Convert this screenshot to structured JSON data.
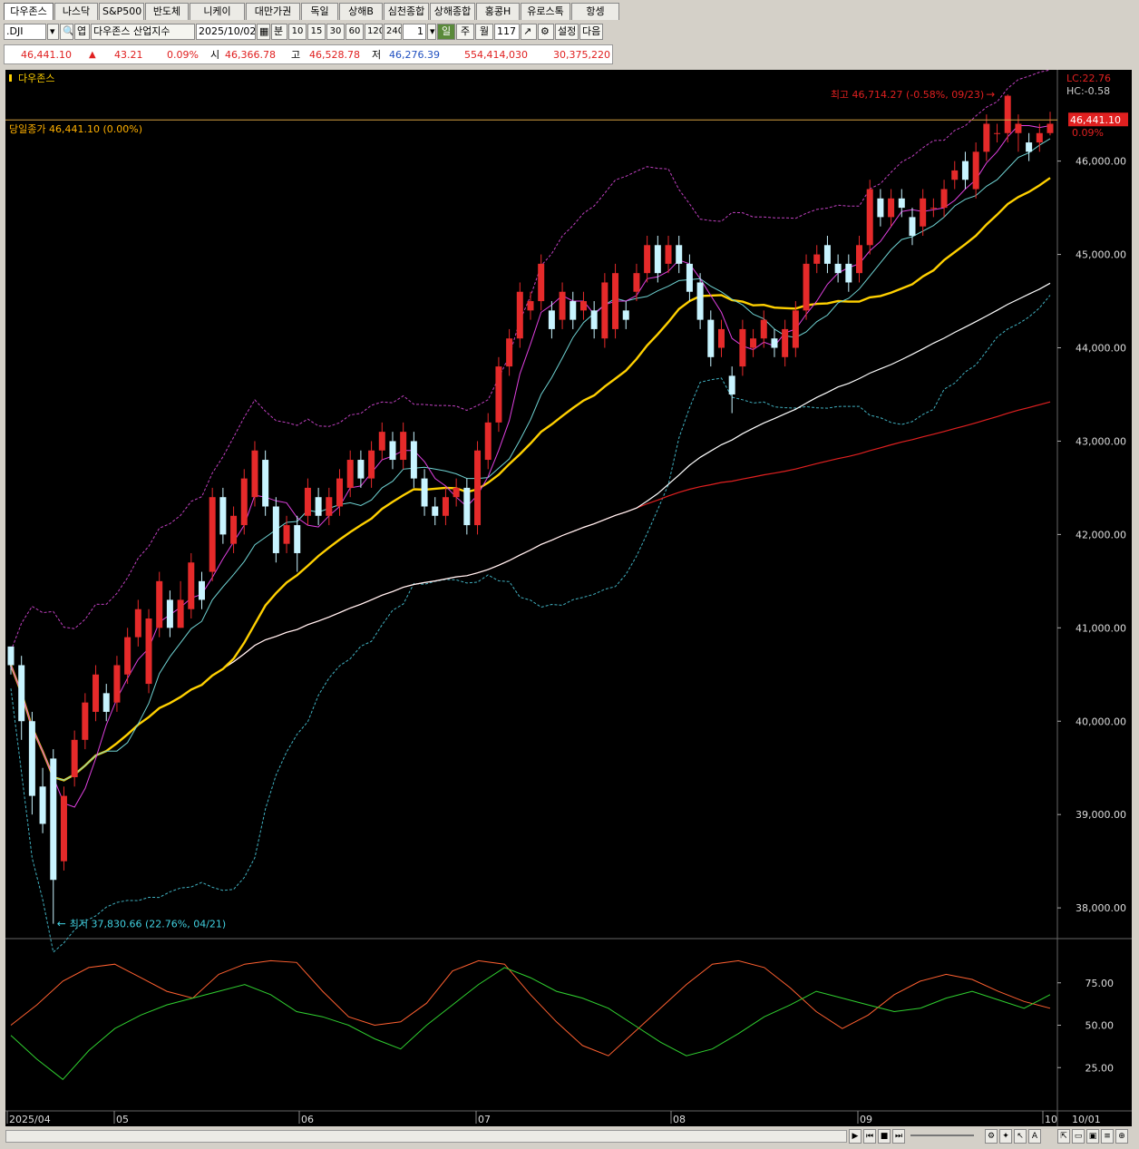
{
  "tabs": [
    "다우존스",
    "나스닥",
    "S&P500",
    "반도체",
    "니케이",
    "대만가권",
    "독일",
    "상해B",
    "심천종합",
    "상해종합",
    "홍콩H",
    "유로스톡",
    "항셍"
  ],
  "toolbar": {
    "symbol": ".DJI",
    "index_name": "다우존스 산업지수",
    "date": "2025/10/02",
    "period_unit": "분",
    "minute_options": [
      "10",
      "15",
      "30",
      "60",
      "120",
      "240"
    ],
    "multiplier": "1",
    "period_day": "일",
    "period_week": "주",
    "period_month": "월",
    "count": "117",
    "settings_label": "설정",
    "next_label": "다음"
  },
  "quote": {
    "price": "46,441.10",
    "change": "43.21",
    "change_pct": "0.09%",
    "open_label": "시",
    "open": "46,366.78",
    "high_label": "고",
    "high": "46,528.78",
    "low_label": "저",
    "low": "46,276.39",
    "volume": "554,414,030",
    "amount": "30,375,220"
  },
  "chart": {
    "title": "다우존스",
    "close_label": "당일종가 46,441.10 (0.00%)",
    "high_annotation": "최고 46,714.27 (-0.58%, 09/23)",
    "low_annotation": "최저 37,830.66 (22.76%, 04/21)",
    "lc_label": "LC:22.76",
    "hc_label": "HC:-0.58",
    "current_price_tag": "46,441.10",
    "current_pct_tag": "0.09%",
    "y_ticks": [
      "46,000.00",
      "45,000.00",
      "44,000.00",
      "43,000.00",
      "42,000.00",
      "41,000.00",
      "40,000.00",
      "39,000.00",
      "38,000.00"
    ],
    "osc_ticks": [
      "75.00",
      "50.00",
      "25.00"
    ],
    "x_labels": [
      "2025/04",
      "05",
      "06",
      "07",
      "08",
      "09",
      "10",
      "10/01"
    ],
    "colors": {
      "up": "#e52a2a",
      "down": "#c8f4ff",
      "ma5": "#e040e0",
      "ma10": "#6fd3d3",
      "ma20": "#ffd000",
      "ma60": "#ffffff",
      "ma120": "#e02020"
    }
  },
  "chart_data": {
    "type": "candlestick",
    "x_range": [
      "2025/04/08",
      "2025/10/02"
    ],
    "ylim": [
      37700,
      46900
    ],
    "points": [
      [
        40800,
        40600,
        40700,
        40500
      ],
      [
        40600,
        40000,
        40700,
        39800
      ],
      [
        40000,
        39200,
        40100,
        39000
      ],
      [
        39300,
        38900,
        39500,
        38800
      ],
      [
        39600,
        38300,
        39700,
        37830
      ],
      [
        38500,
        39200,
        39300,
        38400
      ],
      [
        39400,
        39800,
        39900,
        39300
      ],
      [
        39800,
        40200,
        40300,
        39700
      ],
      [
        40100,
        40500,
        40600,
        40000
      ],
      [
        40300,
        40100,
        40400,
        40000
      ],
      [
        40200,
        40600,
        40700,
        40100
      ],
      [
        40500,
        40900,
        41000,
        40400
      ],
      [
        40900,
        41200,
        41300,
        40800
      ],
      [
        40400,
        41100,
        41200,
        40300
      ],
      [
        41000,
        41500,
        41600,
        40900
      ],
      [
        41300,
        41000,
        41400,
        40900
      ],
      [
        41000,
        41300,
        41500,
        41000
      ],
      [
        41200,
        41700,
        41800,
        41100
      ],
      [
        41500,
        41300,
        41600,
        41200
      ],
      [
        41600,
        42400,
        42500,
        41500
      ],
      [
        42400,
        42000,
        42500,
        41900
      ],
      [
        41900,
        42200,
        42300,
        41800
      ],
      [
        42100,
        42600,
        42700,
        42000
      ],
      [
        42400,
        42900,
        43000,
        42300
      ],
      [
        42800,
        42300,
        42900,
        42200
      ],
      [
        42300,
        41800,
        42400,
        41700
      ],
      [
        41900,
        42100,
        42200,
        41800
      ],
      [
        42100,
        41800,
        42200,
        41600
      ],
      [
        42200,
        42500,
        42600,
        42100
      ],
      [
        42400,
        42200,
        42500,
        42100
      ],
      [
        42200,
        42400,
        42500,
        42100
      ],
      [
        42300,
        42600,
        42700,
        42200
      ],
      [
        42500,
        42800,
        42900,
        42400
      ],
      [
        42800,
        42600,
        42900,
        42500
      ],
      [
        42600,
        42900,
        43000,
        42500
      ],
      [
        42900,
        43100,
        43200,
        42800
      ],
      [
        43000,
        42800,
        43100,
        42700
      ],
      [
        42800,
        43100,
        43200,
        42700
      ],
      [
        43000,
        42600,
        43100,
        42500
      ],
      [
        42600,
        42300,
        42700,
        42200
      ],
      [
        42300,
        42200,
        42400,
        42100
      ],
      [
        42200,
        42400,
        42500,
        42100
      ],
      [
        42400,
        42500,
        42600,
        42300
      ],
      [
        42500,
        42100,
        42600,
        42000
      ],
      [
        42100,
        42900,
        43000,
        42000
      ],
      [
        42800,
        43200,
        43300,
        42700
      ],
      [
        43200,
        43800,
        43900,
        43100
      ],
      [
        43800,
        44100,
        44200,
        43700
      ],
      [
        44100,
        44600,
        44700,
        44000
      ],
      [
        44400,
        44500,
        44600,
        44300
      ],
      [
        44500,
        44900,
        45000,
        44400
      ],
      [
        44400,
        44200,
        44500,
        44100
      ],
      [
        44300,
        44600,
        44700,
        44200
      ],
      [
        44500,
        44300,
        44600,
        44200
      ],
      [
        44400,
        44500,
        44600,
        44300
      ],
      [
        44400,
        44200,
        44500,
        44100
      ],
      [
        44100,
        44700,
        44800,
        44000
      ],
      [
        44200,
        44800,
        44900,
        44100
      ],
      [
        44400,
        44300,
        44500,
        44200
      ],
      [
        44600,
        44800,
        44900,
        44500
      ],
      [
        44800,
        45100,
        45200,
        44700
      ],
      [
        45100,
        44800,
        45200,
        44700
      ],
      [
        44900,
        45100,
        45200,
        44800
      ],
      [
        45100,
        44900,
        45200,
        44800
      ],
      [
        44900,
        44600,
        45000,
        44500
      ],
      [
        44700,
        44300,
        44800,
        44200
      ],
      [
        44300,
        43900,
        44400,
        43800
      ],
      [
        44000,
        44200,
        44300,
        43900
      ],
      [
        43700,
        43500,
        43800,
        43300
      ],
      [
        43800,
        44200,
        44300,
        43700
      ],
      [
        44000,
        44100,
        44200,
        43900
      ],
      [
        44100,
        44300,
        44400,
        44000
      ],
      [
        44100,
        44000,
        44200,
        43900
      ],
      [
        43900,
        44200,
        44300,
        43800
      ],
      [
        44000,
        44400,
        44500,
        43900
      ],
      [
        44400,
        44900,
        45000,
        44300
      ],
      [
        44900,
        45000,
        45100,
        44800
      ],
      [
        45100,
        44900,
        45200,
        44800
      ],
      [
        44900,
        44800,
        45000,
        44700
      ],
      [
        44900,
        44700,
        45000,
        44600
      ],
      [
        44800,
        45100,
        45200,
        44700
      ],
      [
        45100,
        45700,
        45800,
        45000
      ],
      [
        45600,
        45400,
        45700,
        45300
      ],
      [
        45400,
        45600,
        45700,
        45300
      ],
      [
        45600,
        45500,
        45700,
        45400
      ],
      [
        45400,
        45200,
        45500,
        45100
      ],
      [
        45300,
        45600,
        45700,
        45200
      ],
      [
        45500,
        45500,
        45600,
        45400
      ],
      [
        45500,
        45700,
        45800,
        45400
      ],
      [
        45800,
        45900,
        46000,
        45700
      ],
      [
        46000,
        45800,
        46100,
        45700
      ],
      [
        45700,
        46100,
        46200,
        45600
      ],
      [
        46100,
        46400,
        46500,
        46000
      ],
      [
        46300,
        46300,
        46400,
        46200
      ],
      [
        46300,
        46700,
        46714,
        46200
      ],
      [
        46300,
        46400,
        46500,
        46100
      ],
      [
        46200,
        46100,
        46300,
        46000
      ],
      [
        46200,
        46300,
        46400,
        46100
      ],
      [
        46300,
        46400,
        46529,
        46276
      ]
    ],
    "oscillator": {
      "slow_k": [
        50,
        62,
        76,
        84,
        86,
        78,
        70,
        66,
        80,
        86,
        88,
        87,
        70,
        55,
        50,
        52,
        63,
        82,
        88,
        86,
        68,
        52,
        38,
        32,
        46,
        60,
        74,
        86,
        88,
        84,
        72,
        58,
        48,
        56,
        68,
        76,
        80,
        77,
        70,
        64,
        60
      ],
      "slow_d": [
        44,
        30,
        18,
        35,
        48,
        56,
        62,
        66,
        70,
        74,
        68,
        58,
        55,
        50,
        42,
        36,
        50,
        62,
        74,
        84,
        78,
        70,
        66,
        60,
        50,
        40,
        32,
        36,
        45,
        55,
        62,
        70,
        66,
        62,
        58,
        60,
        66,
        70,
        65,
        60,
        68
      ]
    }
  }
}
